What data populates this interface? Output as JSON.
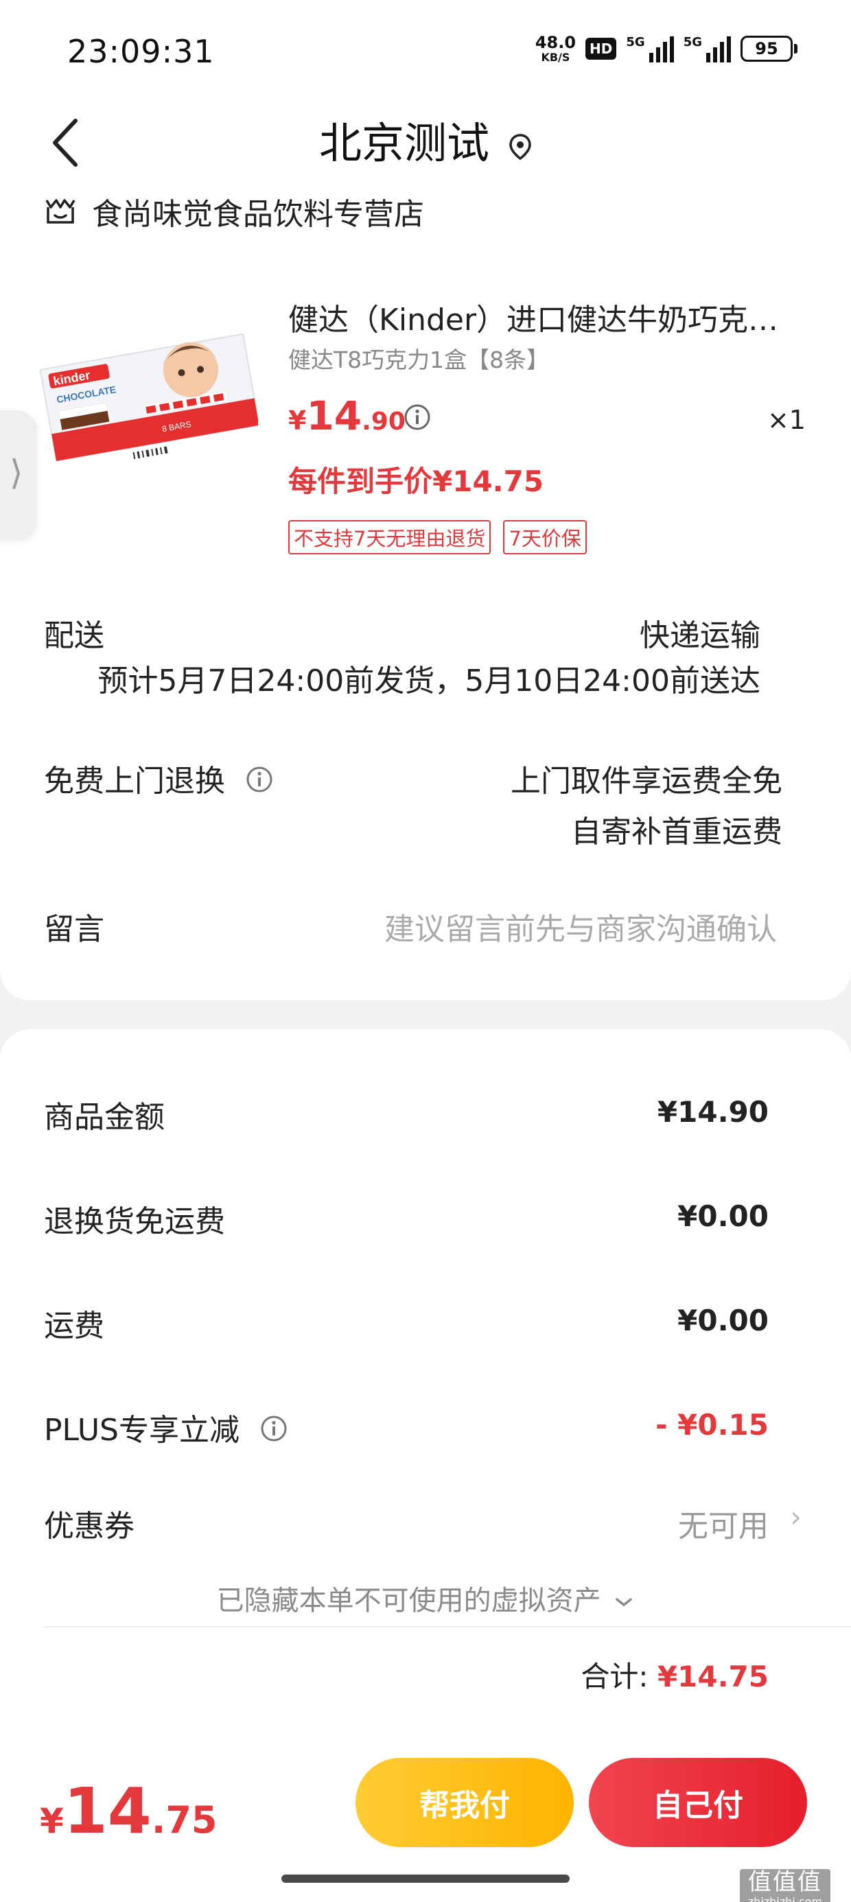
{
  "status_bar": {
    "time": "23:09:31",
    "net_speed_value": "48.0",
    "net_speed_unit": "KB/S",
    "hd_label": "HD",
    "sim1_label": "5G",
    "sim2_label": "5G",
    "battery": "95"
  },
  "header": {
    "title": "北京测试",
    "back_icon": "chevron-left-icon",
    "location_icon": "location-pin-icon"
  },
  "shop": {
    "name": "食尚味觉食品饮料专营店",
    "icon": "store-icon"
  },
  "product": {
    "title": "健达（Kinder）进口健达牛奶巧克…",
    "spec": "健达T8巧克力1盒【8条】",
    "price_currency": "¥",
    "price_int": "14",
    "price_dec": ".90",
    "quantity": "×1",
    "final_price_text": "每件到手价¥14.75",
    "tags": [
      "不支持7天无理由退货",
      "7天价保"
    ],
    "image_brand": "kinder",
    "image_sub": "CHOCOLATE",
    "image_count": "8 BARS"
  },
  "delivery": {
    "label": "配送",
    "method": "快递运输",
    "estimate": "预计5月7日24:00前发货，5月10日24:00前送达"
  },
  "return_service": {
    "label": "免费上门退换",
    "line1": "上门取件享运费全免",
    "line2": "自寄补首重运费"
  },
  "message": {
    "label": "留言",
    "placeholder": "建议留言前先与商家沟通确认"
  },
  "summary": {
    "goods_amount_label": "商品金额",
    "goods_amount": "¥14.90",
    "return_shipping_label": "退换货免运费",
    "return_shipping": "¥0.00",
    "shipping_label": "运费",
    "shipping": "¥0.00",
    "plus_label": "PLUS专享立减",
    "plus_discount": "- ¥0.15",
    "coupon_label": "优惠券",
    "coupon_value": "无可用",
    "hidden_assets": "已隐藏本单不可使用的虚拟资产",
    "total_label": "合计:",
    "total": "¥14.75"
  },
  "bottom_bar": {
    "price_currency": "¥",
    "price_int": "14",
    "price_dec": ".75",
    "help_pay_label": "帮我付",
    "self_pay_label": "自己付"
  },
  "watermark": {
    "main": "值值值",
    "sub": "zhizhizhi.com"
  },
  "colors": {
    "accent_red": "#e4393c",
    "help_button": "#ffb300",
    "self_button": "#e51f2c"
  }
}
